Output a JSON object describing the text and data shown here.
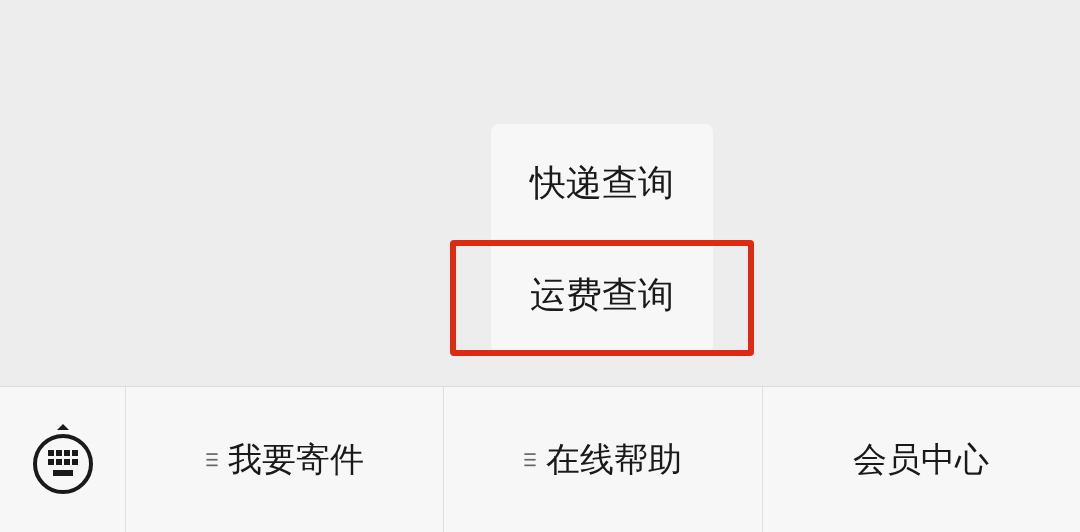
{
  "popup_menu": {
    "items": [
      {
        "label": "快递查询",
        "highlighted": false
      },
      {
        "label": "运费查询",
        "highlighted": true
      }
    ]
  },
  "bottom_menu": {
    "buttons": [
      {
        "label": "我要寄件",
        "has_submenu": true
      },
      {
        "label": "在线帮助",
        "has_submenu": true
      },
      {
        "label": "会员中心",
        "has_submenu": false
      }
    ]
  }
}
